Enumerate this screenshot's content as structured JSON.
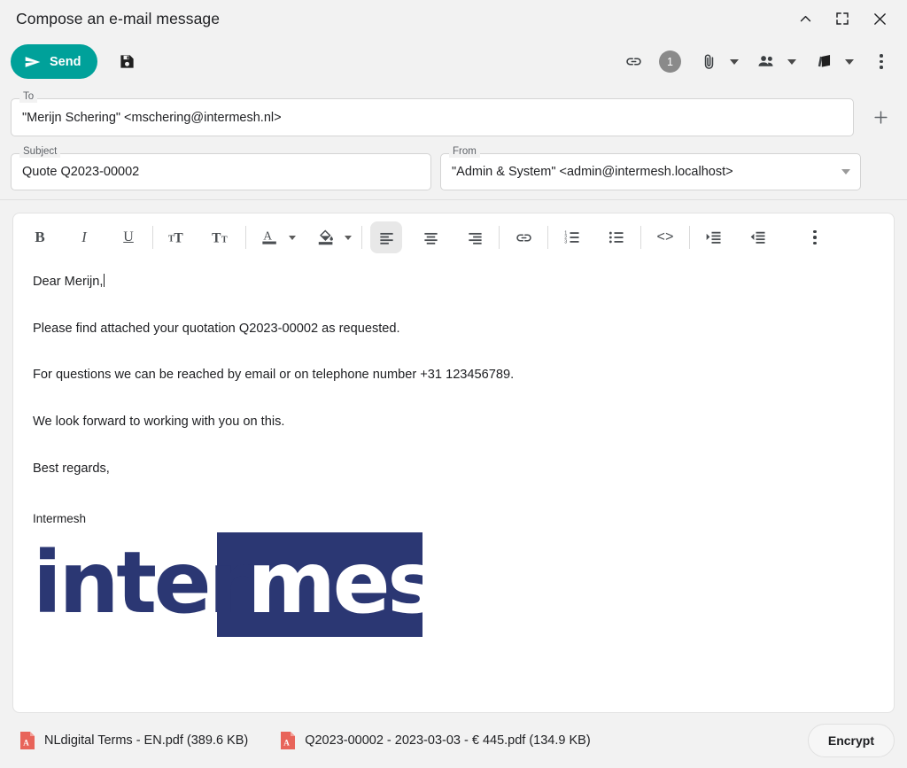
{
  "window": {
    "title": "Compose an e-mail message",
    "controls": [
      {
        "name": "collapse",
        "icon": "chevron-up-icon"
      },
      {
        "name": "expand",
        "icon": "expand-icon"
      },
      {
        "name": "close",
        "icon": "close-icon"
      }
    ]
  },
  "toolbar": {
    "send_label": "Send",
    "save_icon": "save-disk-icon",
    "link_icon": "link-icon",
    "link_badge": "1",
    "attach_icon": "paperclip-icon",
    "contacts_icon": "people-icon",
    "template_icon": "template-card-icon",
    "more_icon": "more-vertical-icon"
  },
  "fields": {
    "to": {
      "label": "To",
      "value": "\"Merijn Schering\" <mschering@intermesh.nl>"
    },
    "subject": {
      "label": "Subject",
      "value": "Quote Q2023-00002"
    },
    "from": {
      "label": "From",
      "value": "\"Admin & System\" <admin@intermesh.localhost>"
    },
    "add_recipient_icon": "plus-icon"
  },
  "format_toolbar": {
    "bold": "B",
    "italic": "I",
    "underline": "U",
    "increase_font": "increase-font-size-icon",
    "decrease_font": "decrease-font-size-icon",
    "text_color": "A",
    "fill_color": "fill-color-icon",
    "align_left": "align-left-icon",
    "align_center": "align-center-icon",
    "align_right": "align-right-icon",
    "insert_link": "link-icon",
    "ordered_list": "ordered-list-icon",
    "unordered_list": "unordered-list-icon",
    "source_code": "<>",
    "indent": "indent-icon",
    "outdent": "outdent-icon",
    "more": "more-vertical-icon"
  },
  "body": {
    "paragraphs": [
      "Dear Merijn,",
      "Please find attached your quotation Q2023-00002 as requested.",
      "For questions we can be reached by email or on telephone number +31 123456789.",
      "We look forward to working with you on this.",
      "Best regards,"
    ],
    "signature_name": "Intermesh",
    "logo": {
      "part_one": "inter",
      "part_two": "mesh",
      "color": "#2b3773"
    }
  },
  "attachments": [
    {
      "name": "NLdigital Terms - EN.pdf (389.6 KB)",
      "type": "pdf"
    },
    {
      "name": "Q2023-00002 - 2023-03-03 - € 445.pdf (134.9 KB)",
      "type": "pdf"
    }
  ],
  "footer": {
    "encrypt_label": "Encrypt"
  },
  "colors": {
    "accent": "#00a19a",
    "logo_navy": "#2b3773",
    "pdf_red": "#e8645a",
    "badge_gray": "#8a8a8a"
  }
}
